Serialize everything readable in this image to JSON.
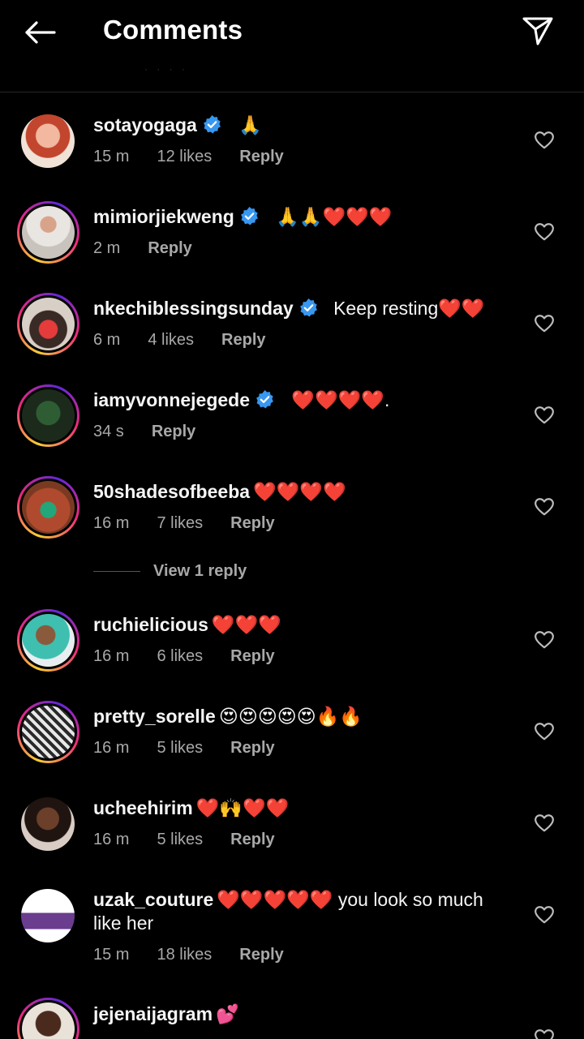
{
  "header": {
    "title": "Comments",
    "back_icon": "arrow-left-icon",
    "share_icon": "paper-plane-icon"
  },
  "colors": {
    "background": "#000000",
    "verified": "#3897f0",
    "meta_text": "#a8a8a8",
    "divider": "#262626"
  },
  "comments": [
    {
      "username": "sotayogaga",
      "verified": true,
      "text": "🙏",
      "time": "15 m",
      "likes": "12 likes",
      "reply": "Reply"
    },
    {
      "username": "mimiorjiekweng",
      "verified": true,
      "text": "🙏🙏❤️❤️❤️",
      "time": "2 m",
      "likes": "",
      "reply": "Reply"
    },
    {
      "username": "nkechiblessingsunday",
      "verified": true,
      "text": "Keep resting❤️❤️",
      "time": "6 m",
      "likes": "4 likes",
      "reply": "Reply"
    },
    {
      "username": "iamyvonnejegede",
      "verified": true,
      "text": "❤️❤️❤️❤️.",
      "time": "34 s",
      "likes": "",
      "reply": "Reply"
    },
    {
      "username": "50shadesofbeeba",
      "verified": false,
      "text": "❤️❤️❤️❤️",
      "time": "16 m",
      "likes": "7 likes",
      "reply": "Reply"
    },
    {
      "username": "ruchielicious",
      "verified": false,
      "text": "❤️❤️❤️",
      "time": "16 m",
      "likes": "6 likes",
      "reply": "Reply"
    },
    {
      "username": "pretty_sorelle",
      "verified": false,
      "text": "😍😍😍😍😍🔥🔥",
      "time": "16 m",
      "likes": "5 likes",
      "reply": "Reply"
    },
    {
      "username": "ucheehirim",
      "verified": false,
      "text": "❤️🙌❤️❤️",
      "time": "16 m",
      "likes": "5 likes",
      "reply": "Reply"
    },
    {
      "username": "uzak_couture",
      "verified": false,
      "text": "❤️❤️❤️❤️❤️ you look so much like her",
      "time": "15 m",
      "likes": "18 likes",
      "reply": "Reply"
    },
    {
      "username": "jejenaijagram",
      "verified": false,
      "text": "💕",
      "time": "",
      "likes": "",
      "reply": ""
    }
  ],
  "view_replies": {
    "label": "View 1 reply"
  }
}
